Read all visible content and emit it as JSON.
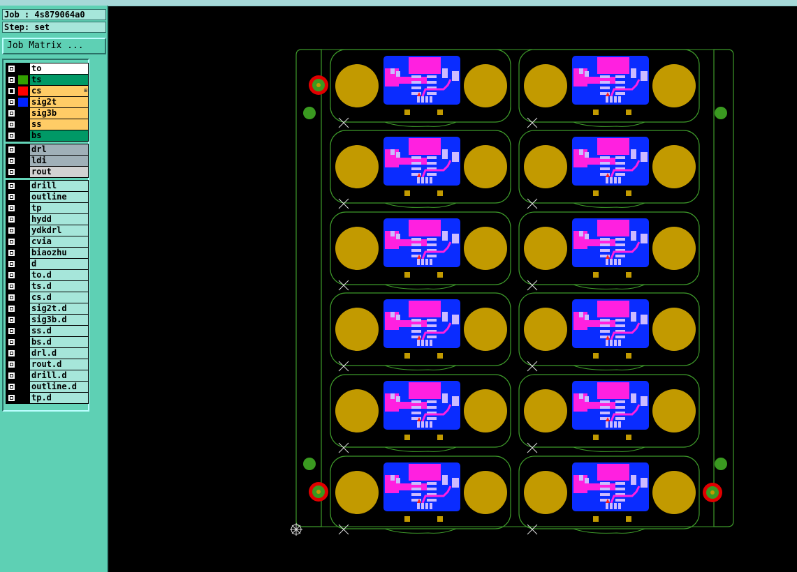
{
  "job": {
    "label": "Job : 4s879064a0",
    "step": "Step: set"
  },
  "job_matrix_button": "Job Matrix ...",
  "colors": {
    "board_layer": "#ffcc66",
    "selected_layer": "#009966",
    "drill_layer": "#a0b0b8",
    "doc_layer": "#a6e6da",
    "pad": "#c29a00",
    "ic_body": "#0a2cff",
    "copper_pink": "#ff20e0",
    "outline": "#3e9a2a",
    "fiducial": "#e00000"
  },
  "layer_groups": [
    [
      {
        "name": "to",
        "bg": "#ffffff",
        "swatch": "",
        "active": false
      },
      {
        "name": "ts",
        "bg": "#009966",
        "swatch": "#33a000",
        "active": false
      },
      {
        "name": "cs",
        "bg": "#ffcc66",
        "swatch": "#ff0000",
        "active": true,
        "mark": "⊞"
      },
      {
        "name": "sig2t",
        "bg": "#ffcc66",
        "swatch": "#0022ff",
        "active": false
      },
      {
        "name": "sig3b",
        "bg": "#ffcc66",
        "swatch": "",
        "active": false
      },
      {
        "name": "ss",
        "bg": "#ffcc66",
        "swatch": "",
        "active": false
      },
      {
        "name": "bs",
        "bg": "#009966",
        "swatch": "",
        "active": false
      }
    ],
    [
      {
        "name": "drl",
        "bg": "#a0b0b8",
        "swatch": "",
        "active": false
      },
      {
        "name": "ldi",
        "bg": "#a0b0b8",
        "swatch": "",
        "active": false
      },
      {
        "name": "rout",
        "bg": "#d2d2d2",
        "swatch": "",
        "active": false
      }
    ],
    [
      {
        "name": "drill",
        "bg": "#a6e6da",
        "swatch": "",
        "active": false
      },
      {
        "name": "outline",
        "bg": "#a6e6da",
        "swatch": "",
        "active": false
      },
      {
        "name": "tp",
        "bg": "#a6e6da",
        "swatch": "",
        "active": false
      },
      {
        "name": "hydd",
        "bg": "#a6e6da",
        "swatch": "",
        "active": false
      },
      {
        "name": "ydkdrl",
        "bg": "#a6e6da",
        "swatch": "",
        "active": false
      },
      {
        "name": "cvia",
        "bg": "#a6e6da",
        "swatch": "",
        "active": false
      },
      {
        "name": "biaozhu",
        "bg": "#a6e6da",
        "swatch": "",
        "active": false
      },
      {
        "name": "d",
        "bg": "#a6e6da",
        "swatch": "",
        "active": false
      },
      {
        "name": "to.d",
        "bg": "#a6e6da",
        "swatch": "",
        "active": false
      },
      {
        "name": "ts.d",
        "bg": "#a6e6da",
        "swatch": "",
        "active": false
      },
      {
        "name": "cs.d",
        "bg": "#a6e6da",
        "swatch": "",
        "active": false
      },
      {
        "name": "sig2t.d",
        "bg": "#a6e6da",
        "swatch": "",
        "active": false
      },
      {
        "name": "sig3b.d",
        "bg": "#a6e6da",
        "swatch": "",
        "active": false
      },
      {
        "name": "ss.d",
        "bg": "#a6e6da",
        "swatch": "",
        "active": false
      },
      {
        "name": "bs.d",
        "bg": "#a6e6da",
        "swatch": "",
        "active": false
      },
      {
        "name": "drl.d",
        "bg": "#a6e6da",
        "swatch": "",
        "active": false
      },
      {
        "name": "rout.d",
        "bg": "#a6e6da",
        "swatch": "",
        "active": false
      },
      {
        "name": "drill.d",
        "bg": "#a6e6da",
        "swatch": "",
        "active": false
      },
      {
        "name": "outline.d",
        "bg": "#a6e6da",
        "swatch": "",
        "active": false
      },
      {
        "name": "tp.d",
        "bg": "#a6e6da",
        "swatch": "",
        "active": false
      }
    ]
  ],
  "panel": {
    "columns": 2,
    "rows": 6
  }
}
